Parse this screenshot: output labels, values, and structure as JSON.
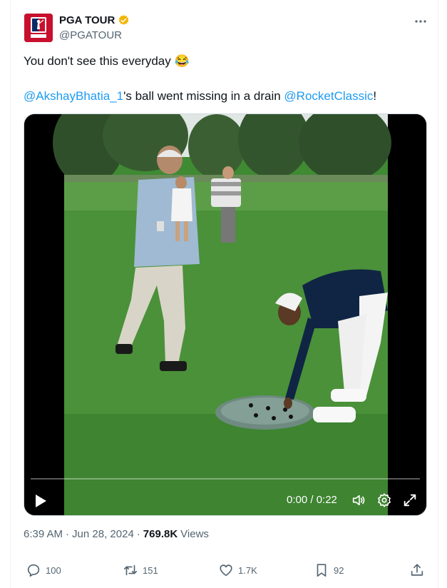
{
  "author": {
    "display_name": "PGA TOUR",
    "handle": "@PGATOUR",
    "verified": true,
    "verified_color": "#f4b400",
    "avatar_color": "#c8102e"
  },
  "tweet": {
    "line1_text": "You don't see this everyday",
    "line1_emoji": "😂",
    "mention1": "@AkshayBhatia_1",
    "middle_text": "'s ball went missing in a drain ",
    "mention2": "@RocketClassic",
    "end_text": "!"
  },
  "video": {
    "time": "0:00 / 0:22",
    "progress": 0
  },
  "meta": {
    "time": "6:39 AM",
    "sep1": "·",
    "date": "Jun 28, 2024",
    "sep2": "·",
    "views_count": "769.8K",
    "views_label": "Views"
  },
  "actions": {
    "replies": "100",
    "reposts": "151",
    "likes": "1.7K",
    "bookmarks": "92"
  },
  "colors": {
    "link": "#1d9bf0",
    "secondary_text": "#536471",
    "grass": "#3f8a33"
  },
  "icons": [
    "verified-badge-icon",
    "more-icon",
    "play-icon",
    "volume-icon",
    "settings-icon",
    "fullscreen-icon",
    "reply-icon",
    "repost-icon",
    "like-icon",
    "bookmark-icon",
    "share-icon"
  ]
}
